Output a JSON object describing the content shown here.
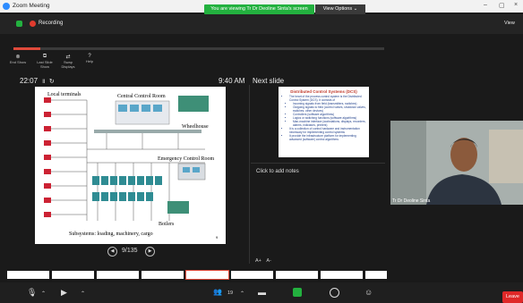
{
  "titlebar": {
    "title": "Zoom Meeting"
  },
  "share_banner": {
    "viewing_text": "You are viewing Tr Dr Deoline Sinta's screen",
    "view_options": "View Options ⌄"
  },
  "window_controls": {
    "minimize": "–",
    "restore": "▢",
    "close": "×"
  },
  "status": {
    "recording": "Recording",
    "view": "View"
  },
  "toolbar": [
    {
      "icon": "end-icon",
      "glyph": "⊗",
      "label": "End Show"
    },
    {
      "icon": "slides-icon",
      "glyph": "⧉",
      "label": "Last Slide Show"
    },
    {
      "icon": "swap-icon",
      "glyph": "⇄",
      "label": "Swap Displays"
    },
    {
      "icon": "help-icon",
      "glyph": "?",
      "label": "Help"
    }
  ],
  "timer": {
    "elapsed": "22:07",
    "pause_glyph": "II",
    "reset_glyph": "↻",
    "clock": "9:40 AM",
    "next_label": "Next slide"
  },
  "main_slide": {
    "labels": [
      "Local terminals",
      "Central Control Room",
      "Wheelhouse",
      "Emergency Control Room",
      "Boilers",
      "Subsystems: loading, machinery, cargo"
    ],
    "page": "9"
  },
  "navigation": {
    "prev": "◀",
    "counter": "9/135",
    "next": "▶"
  },
  "next_slide": {
    "title": "Distributed Control Systems (DCS)",
    "bullets": [
      "The heart of the process control system is the Distributed Control System (DCS). It consists of",
      "Incoming signals from field (transmitters, switches)",
      "Outgoing signals to field (control valves, shutdown valves, switches, other devices)",
      "Controllers (software algorithms)",
      "Logics or switching functions (software algorithms)",
      "Man-machine interface (workstations, displays, recorders, alarms, indicators, printers)",
      "It is a collection of control hardware and instrumentation necessary for implementing control systems",
      "It provide the infrastructure platform for implementing advanced (software) control algorithms"
    ]
  },
  "notes": {
    "placeholder": "Click to add notes"
  },
  "font_controls": {
    "larger": "A+",
    "smaller": "A-"
  },
  "video": {
    "name": "Tr Dr Deoline Sinta"
  },
  "thumbnails": {
    "count": 9,
    "active_index": 4
  },
  "bottom": {
    "participants_count": "19",
    "leave": "Leave"
  },
  "colors": {
    "accent_green": "#23b13f",
    "record_red": "#e03b2e",
    "leave_red": "#e02828",
    "slide_label_red": "#c0392b"
  }
}
